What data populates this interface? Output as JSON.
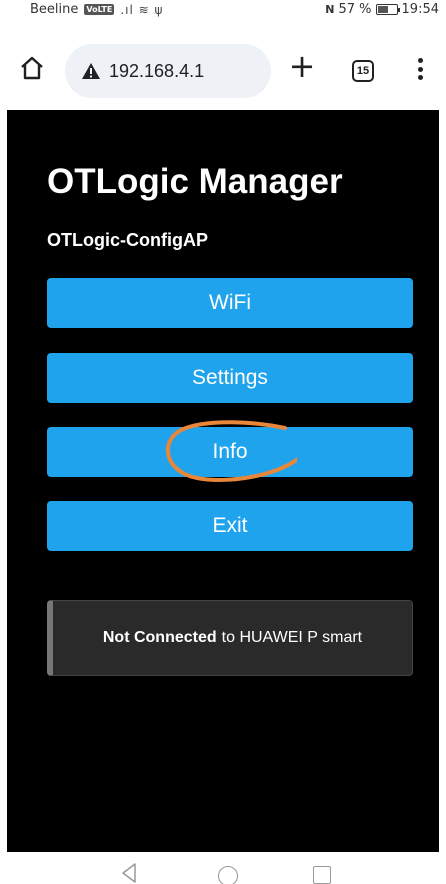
{
  "status_bar": {
    "carrier": "Beeline",
    "volte_badge": "VoLTE",
    "signal_glyphs": ".ıl ≋ ψ",
    "nfc": "N",
    "battery_label": "57 %",
    "battery_level_percent": 57,
    "time": "19:54"
  },
  "browser": {
    "url": "192.168.4.1",
    "warning_icon": "warning-triangle-icon",
    "new_tab_label": "+",
    "tab_count": "15"
  },
  "page": {
    "title": "OTLogic Manager",
    "ap_name": "OTLogic-ConfigAP",
    "buttons": [
      {
        "label": "WiFi"
      },
      {
        "label": "Settings"
      },
      {
        "label": "Info"
      },
      {
        "label": "Exit"
      }
    ],
    "status": {
      "bold": "Not Connected",
      "rest": "to HUAWEI P smart"
    },
    "annotation_color": "#e8863a"
  },
  "colors": {
    "button": "#1fa3ec",
    "page_bg": "#000000",
    "status_bg": "#2a2a2a"
  }
}
